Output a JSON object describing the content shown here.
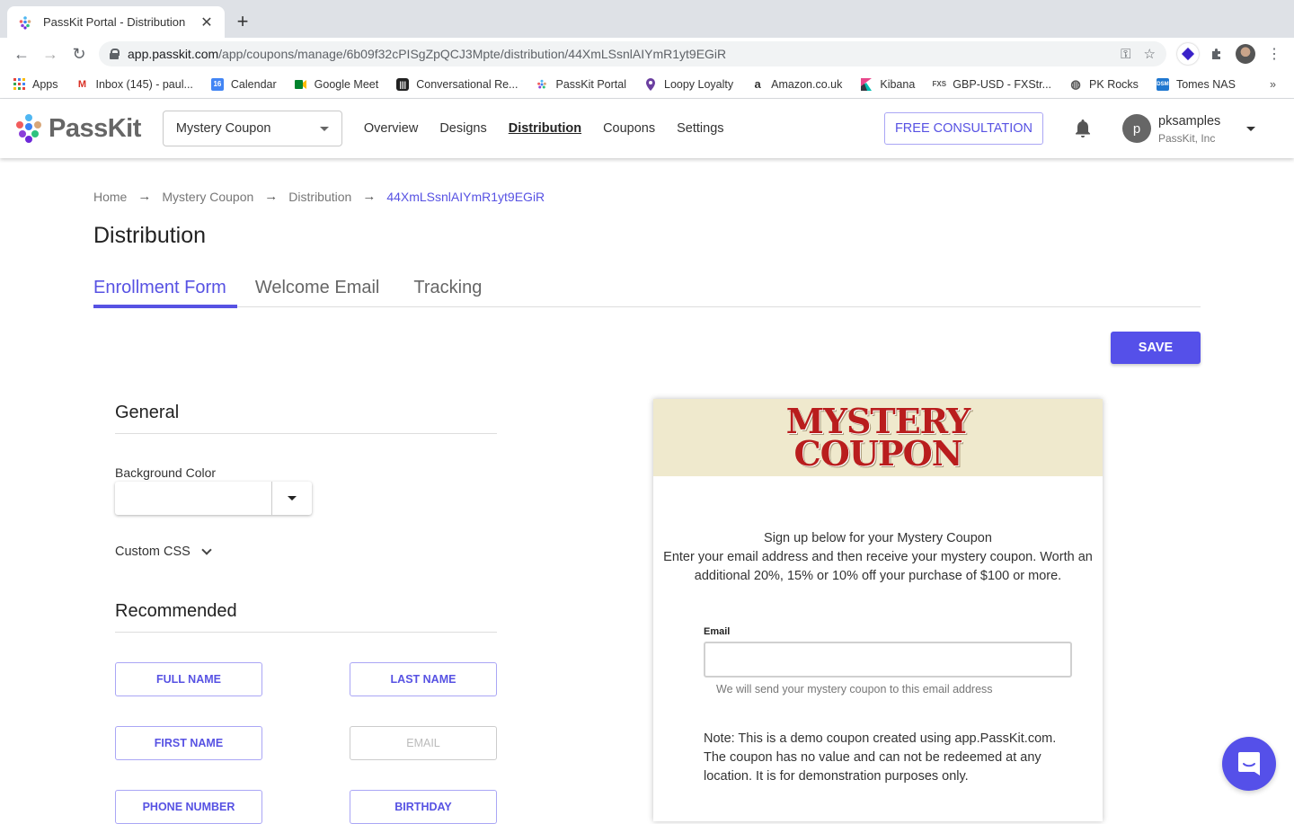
{
  "browser": {
    "tab_title": "PassKit Portal - Distribution",
    "url_host": "app.passkit.com",
    "url_path": "/app/coupons/manage/6b09f32cPISgZpQCJ3Mpte/distribution/44XmLSsnlAIYmR1yt9EGiR",
    "bookmarks": [
      {
        "label": "Apps",
        "icon": "apps-grid-icon"
      },
      {
        "label": "Inbox (145) - paul...",
        "icon": "gmail-icon"
      },
      {
        "label": "Calendar",
        "icon": "calendar-icon"
      },
      {
        "label": "Google Meet",
        "icon": "meet-icon"
      },
      {
        "label": "Conversational Re...",
        "icon": "intercom-icon"
      },
      {
        "label": "PassKit Portal",
        "icon": "passkit-icon"
      },
      {
        "label": "Loopy Loyalty",
        "icon": "location-pin-icon"
      },
      {
        "label": "Amazon.co.uk",
        "icon": "amazon-icon"
      },
      {
        "label": "Kibana",
        "icon": "kibana-icon"
      },
      {
        "label": "GBP-USD - FXStr...",
        "icon": "fxs-icon"
      },
      {
        "label": "PK Rocks",
        "icon": "globe-icon"
      },
      {
        "label": "Tomes NAS",
        "icon": "dsm-icon"
      }
    ],
    "bookmarks_more": "»"
  },
  "header": {
    "logo_text": "PassKit",
    "program_select": "Mystery Coupon",
    "nav": [
      {
        "label": "Overview",
        "active": false
      },
      {
        "label": "Designs",
        "active": false
      },
      {
        "label": "Distribution",
        "active": true
      },
      {
        "label": "Coupons",
        "active": false
      },
      {
        "label": "Settings",
        "active": false
      }
    ],
    "consult_label": "FREE CONSULTATION",
    "user": {
      "initial": "p",
      "name": "pksamples",
      "org": "PassKit, Inc"
    }
  },
  "breadcrumb": [
    {
      "label": "Home"
    },
    {
      "label": "Mystery Coupon"
    },
    {
      "label": "Distribution"
    },
    {
      "label": "44XmLSsnlAIYmR1yt9EGiR"
    }
  ],
  "page_title": "Distribution",
  "tabs": [
    {
      "label": "Enrollment Form",
      "active": true
    },
    {
      "label": "Welcome Email",
      "active": false
    },
    {
      "label": "Tracking",
      "active": false
    }
  ],
  "save_label": "SAVE",
  "general": {
    "title": "General",
    "background_color_label": "Background Color",
    "background_color_value": "",
    "custom_css_label": "Custom CSS"
  },
  "recommended": {
    "title": "Recommended",
    "fields": [
      {
        "label": "FULL NAME",
        "enabled": true
      },
      {
        "label": "LAST NAME",
        "enabled": true
      },
      {
        "label": "FIRST NAME",
        "enabled": true
      },
      {
        "label": "EMAIL",
        "enabled": false
      },
      {
        "label": "PHONE NUMBER",
        "enabled": true
      },
      {
        "label": "BIRTHDAY",
        "enabled": true
      }
    ]
  },
  "preview": {
    "banner_line1": "MYSTERY",
    "banner_line2": "COUPON",
    "intro_title": "Sign up below for your Mystery Coupon",
    "intro_body": "Enter your email address and then receive your mystery coupon. Worth an additional 20%, 15% or 10% off your purchase of $100 or more.",
    "email_label": "Email",
    "email_value": "",
    "email_help": "We will send your mystery coupon to this email address",
    "note": "Note: This is a demo coupon created using app.PassKit.com. The coupon has no value and can not be redeemed at any location. It is for demonstration purposes only."
  },
  "colors": {
    "accent": "#5550e9",
    "banner_bg": "#efe9cd",
    "banner_text": "#b91d1d"
  }
}
